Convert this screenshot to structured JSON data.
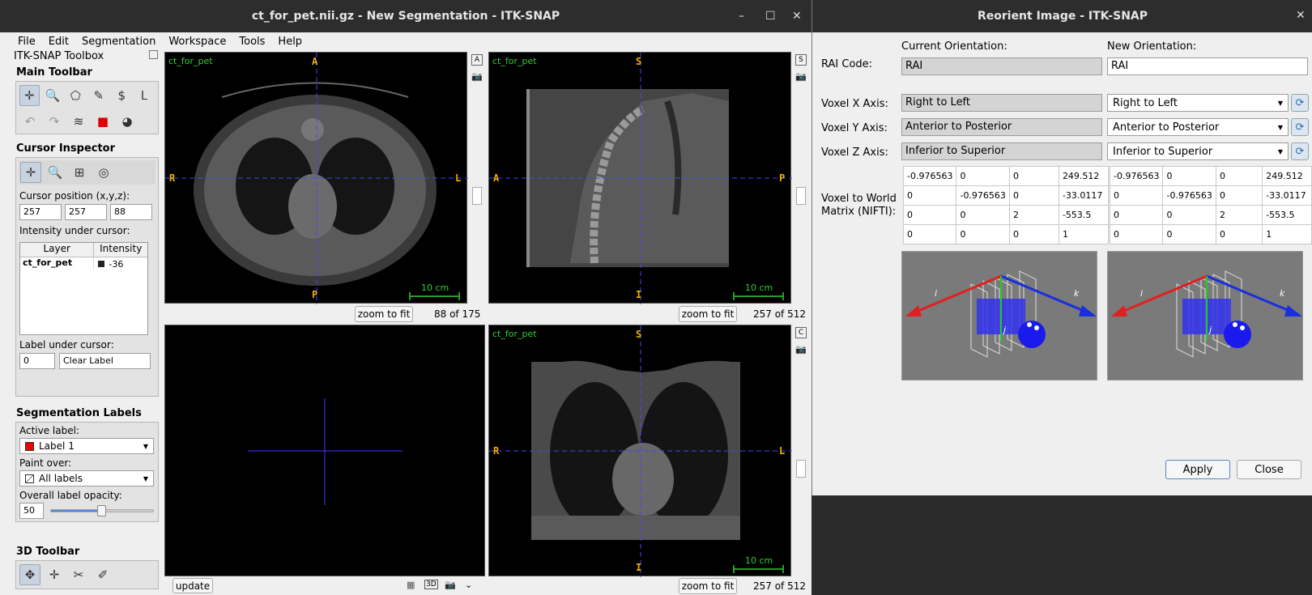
{
  "main_window": {
    "title": "ct_for_pet.nii.gz - New Segmentation - ITK-SNAP",
    "controls": {
      "minimize": "–",
      "maximize": "☐",
      "close": "✕"
    },
    "menu": [
      "File",
      "Edit",
      "Segmentation",
      "Workspace",
      "Tools",
      "Help"
    ]
  },
  "toolbox": {
    "title": "ITK-SNAP Toolbox",
    "main_toolbar": "Main Toolbar",
    "cursor_inspector": {
      "title": "Cursor Inspector",
      "position_label": "Cursor position (x,y,z):",
      "x": "257",
      "y": "257",
      "z": "88",
      "intensity_label": "Intensity under cursor:",
      "col_layer": "Layer",
      "col_intensity": "Intensity",
      "row_layer": "ct_for_pet",
      "row_intensity": "-36",
      "label_under_label": "Label under cursor:",
      "label_id": "0",
      "label_name": "Clear Label"
    },
    "seg_labels": {
      "title": "Segmentation Labels",
      "active_label": "Active label:",
      "active_value": "Label 1",
      "paint_over": "Paint over:",
      "paint_value": "All labels",
      "opacity_label": "Overall label opacity:",
      "opacity_value": "50",
      "opacity": 0.5
    },
    "toolbar_3d": "3D Toolbar"
  },
  "views": {
    "axial": {
      "layer": "ct_for_pet",
      "top": "A",
      "bottom": "P",
      "left": "R",
      "right": "L",
      "scale": "10 cm",
      "zoom": "zoom to fit",
      "slice": "88 of 175",
      "side_letter": "A"
    },
    "sagittal": {
      "layer": "ct_for_pet",
      "top": "S",
      "bottom": "I",
      "left": "A",
      "right": "P",
      "scale": "10 cm",
      "zoom": "zoom to fit",
      "slice": "257 of 512",
      "side_letter": "S"
    },
    "view3d": {
      "update": "update"
    },
    "coronal": {
      "layer": "ct_for_pet",
      "top": "S",
      "bottom": "I",
      "left": "R",
      "right": "L",
      "scale": "10 cm",
      "zoom": "zoom to fit",
      "slice": "257 of 512",
      "side_letter": "C"
    }
  },
  "reorient": {
    "title": "Reorient Image - ITK-SNAP",
    "close_x": "✕",
    "current_orientation": "Current Orientation:",
    "new_orientation": "New Orientation:",
    "rai_label": "RAI Code:",
    "rai_current": "RAI",
    "rai_new": "RAI",
    "x_label": "Voxel X Axis:",
    "y_label": "Voxel Y Axis:",
    "z_label": "Voxel Z Axis:",
    "x_current": "Right to Left",
    "x_new": "Right to Left",
    "y_current": "Anterior to Posterior",
    "y_new": "Anterior to Posterior",
    "z_current": "Inferior to Superior",
    "z_new": "Inferior to Superior",
    "matrix_label": "Voxel to World Matrix (NIFTI):",
    "matrix_current": [
      [
        "-0.976563",
        "0",
        "0",
        "249.512"
      ],
      [
        "0",
        "-0.976563",
        "0",
        "-33.0117"
      ],
      [
        "0",
        "0",
        "2",
        "-553.5"
      ],
      [
        "0",
        "0",
        "0",
        "1"
      ]
    ],
    "matrix_new": [
      [
        "-0.976563",
        "0",
        "0",
        "249.512"
      ],
      [
        "0",
        "-0.976563",
        "0",
        "-33.0117"
      ],
      [
        "0",
        "0",
        "2",
        "-553.5"
      ],
      [
        "0",
        "0",
        "0",
        "1"
      ]
    ],
    "axis_i": "i",
    "axis_j": "j",
    "axis_k": "k",
    "apply": "Apply",
    "close": "Close"
  }
}
